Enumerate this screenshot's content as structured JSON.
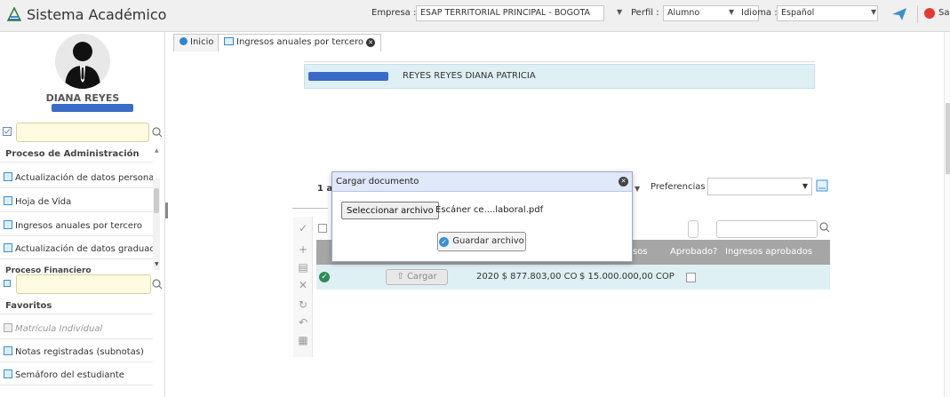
{
  "app": {
    "title": "Sistema Académico"
  },
  "header": {
    "empresa_label": "Empresa :",
    "empresa_value": "ESAP TERRITORIAL PRINCIPAL - BOGOTA",
    "perfil_label": "Perfil :",
    "perfil_value": "Alumno",
    "idioma_label": "Idioma :",
    "idioma_value": "Español",
    "exit_label": "Sa"
  },
  "user": {
    "name": "DIANA REYES"
  },
  "sidebar": {
    "section_admin": "Proceso de Administración",
    "admin_items": [
      {
        "label": "Actualización de datos personale"
      },
      {
        "label": "Hoja de Vida"
      },
      {
        "label": "Ingresos anuales por tercero"
      },
      {
        "label": "Actualización de datos graduado:"
      }
    ],
    "section_financiero": "Proceso Financiero",
    "section_favoritos": "Favoritos",
    "fav_items": [
      {
        "label": "Matrícula Individual"
      },
      {
        "label": "Notas registradas (subnotas)"
      },
      {
        "label": "Semáforo del estudiante"
      }
    ]
  },
  "tabs": [
    {
      "label": "Inicio"
    },
    {
      "label": "Ingresos anuales por tercero"
    }
  ],
  "main": {
    "person_name": "REYES REYES DIANA PATRICIA",
    "pager": "1 a",
    "preferences_label": "Preferencias :",
    "columns": {
      "ingresos": "resos",
      "aprobado": "Aprobado?",
      "ingresos_aprobados": "Ingresos aprobados"
    },
    "row": {
      "upload_label": "Cargar",
      "year_amount": "2020 $ 877.803,00 CO",
      "ingresos": "$ 15.000.000,00 COP",
      "aprobado": 0
    }
  },
  "dialog": {
    "title": "Cargar documento",
    "file_button": "Seleccionar archivo",
    "file_name": "Escáner ce....laboral.pdf",
    "save_button": "Guardar archivo"
  },
  "colors": {
    "accent_blue": "#3a8fd0",
    "highlight_row": "#dff0f5",
    "grid_header": "#a6a6a6",
    "ok_green": "#2e8b57"
  }
}
